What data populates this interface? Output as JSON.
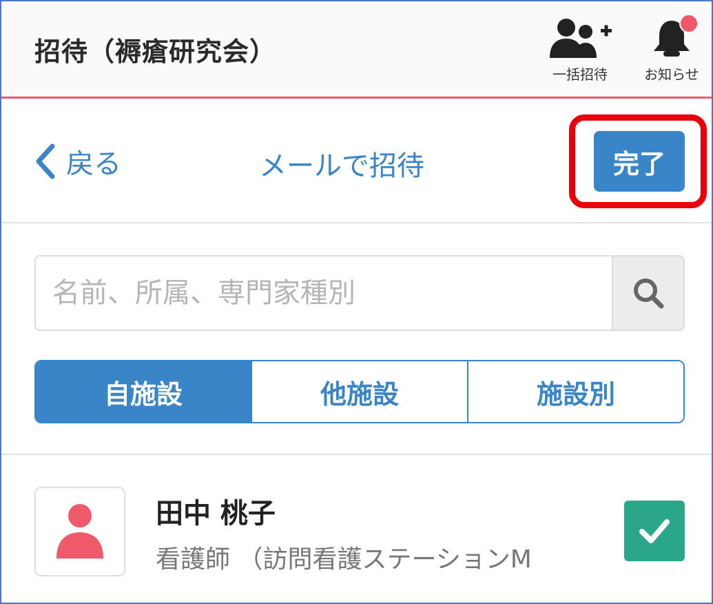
{
  "header": {
    "title": "招待（褥瘡研究会）",
    "bulk_invite_label": "一括招待",
    "notifications_label": "お知らせ",
    "accent_color": "#ef5a6a"
  },
  "nav": {
    "back_label": "戻る",
    "title": "メールで招待",
    "done_label": "完了"
  },
  "search": {
    "placeholder": "名前、所属、専門家種別",
    "value": ""
  },
  "tabs": [
    {
      "label": "自施設",
      "active": true
    },
    {
      "label": "他施設",
      "active": false
    },
    {
      "label": "施設別",
      "active": false
    }
  ],
  "members": [
    {
      "name": "田中 桃子",
      "detail": "看護師 （訪問看護ステーションM",
      "checked": true
    }
  ],
  "colors": {
    "primary": "#3a85c8",
    "check": "#2aa689",
    "avatar": "#ef5a6a",
    "highlight": "#e8000a"
  }
}
